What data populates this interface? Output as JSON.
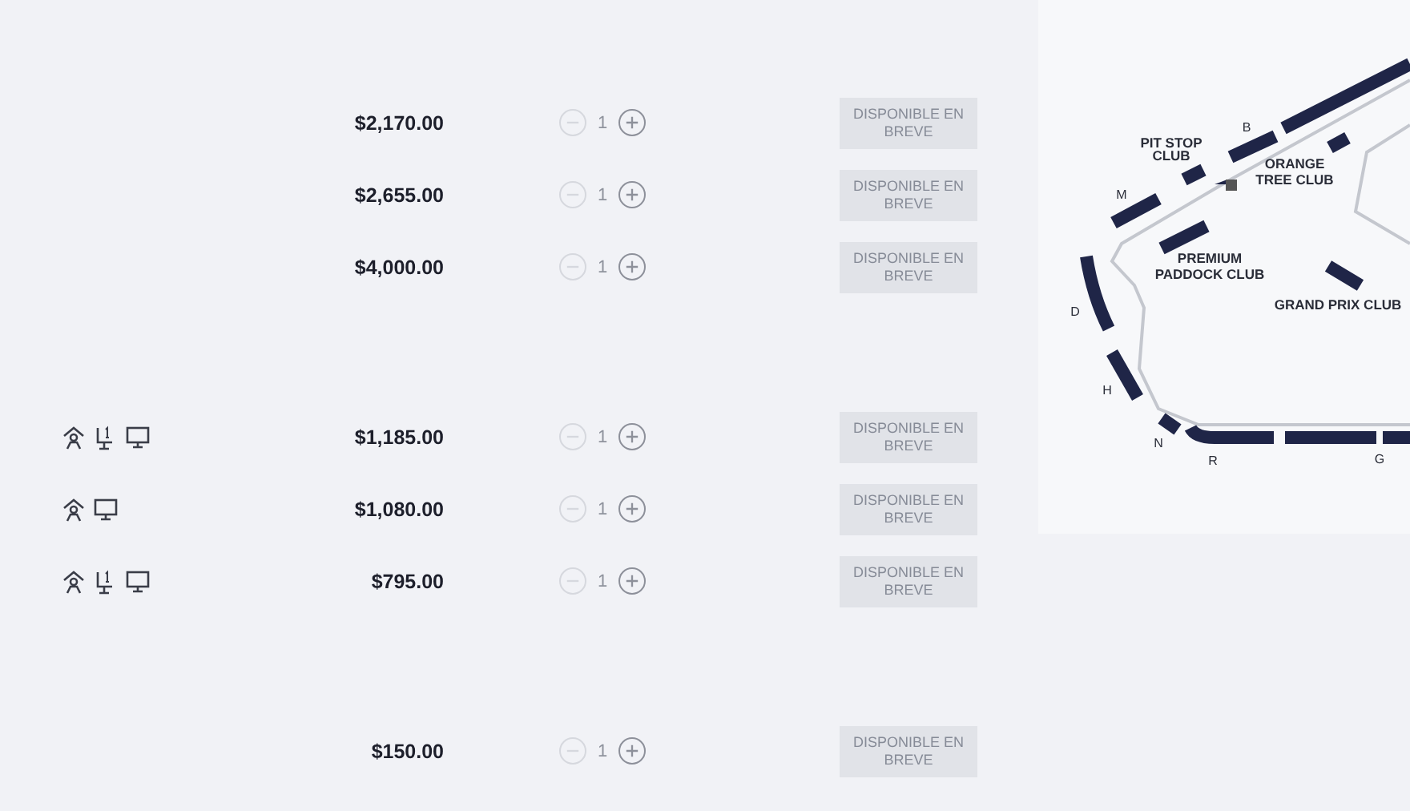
{
  "groups": [
    {
      "rows": [
        {
          "icons": [],
          "price": "$2,170.00",
          "quantity": "1",
          "minus_disabled": true,
          "button": {
            "label": "DISPONIBLE EN BREVE",
            "disabled": true
          }
        },
        {
          "icons": [],
          "price": "$2,655.00",
          "quantity": "1",
          "minus_disabled": true,
          "button": {
            "label": "DISPONIBLE EN BREVE",
            "disabled": true
          }
        },
        {
          "icons": [],
          "price": "$4,000.00",
          "quantity": "1",
          "minus_disabled": true,
          "button": {
            "label": "DISPONIBLE EN BREVE",
            "disabled": true
          }
        }
      ]
    },
    {
      "rows": [
        {
          "icons": [
            {
              "kind": "person"
            },
            {
              "kind": "seat"
            },
            {
              "kind": "screen"
            }
          ],
          "price": "$1,185.00",
          "quantity": "1",
          "minus_disabled": true,
          "button": {
            "label": "DISPONIBLE EN BREVE",
            "disabled": true
          }
        },
        {
          "icons": [
            {
              "kind": "person"
            },
            {
              "kind": "screen"
            }
          ],
          "price": "$1,080.00",
          "quantity": "1",
          "minus_disabled": true,
          "button": {
            "label": "DISPONIBLE EN BREVE",
            "disabled": true
          }
        },
        {
          "icons": [
            {
              "kind": "person"
            },
            {
              "kind": "seat"
            },
            {
              "kind": "screen"
            }
          ],
          "price": "$795.00",
          "quantity": "1",
          "minus_disabled": true,
          "button": {
            "label": "DISPONIBLE EN BREVE",
            "disabled": true
          }
        }
      ]
    },
    {
      "rows": [
        {
          "icons": [],
          "price": "$150.00",
          "quantity": "1",
          "minus_disabled": true,
          "button": {
            "label": "DISPONIBLE EN BREVE",
            "disabled": true
          }
        }
      ]
    }
  ],
  "map": {
    "labels": [
      {
        "text": "B",
        "kind": "section"
      },
      {
        "text": "PIT STOP",
        "kind": "club"
      },
      {
        "text": "CLUB",
        "kind": "club"
      },
      {
        "text": "ORANGE",
        "kind": "club"
      },
      {
        "text": "TREE CLUB",
        "kind": "club"
      },
      {
        "text": "M",
        "kind": "section"
      },
      {
        "text": "PREMIUM",
        "kind": "club"
      },
      {
        "text": "PADDOCK CLUB",
        "kind": "club"
      },
      {
        "text": "GRAND PRIX CLUB",
        "kind": "club"
      },
      {
        "text": "D",
        "kind": "section"
      },
      {
        "text": "H",
        "kind": "section"
      },
      {
        "text": "N",
        "kind": "section"
      },
      {
        "text": "R",
        "kind": "section"
      },
      {
        "text": "G",
        "kind": "section"
      }
    ]
  }
}
